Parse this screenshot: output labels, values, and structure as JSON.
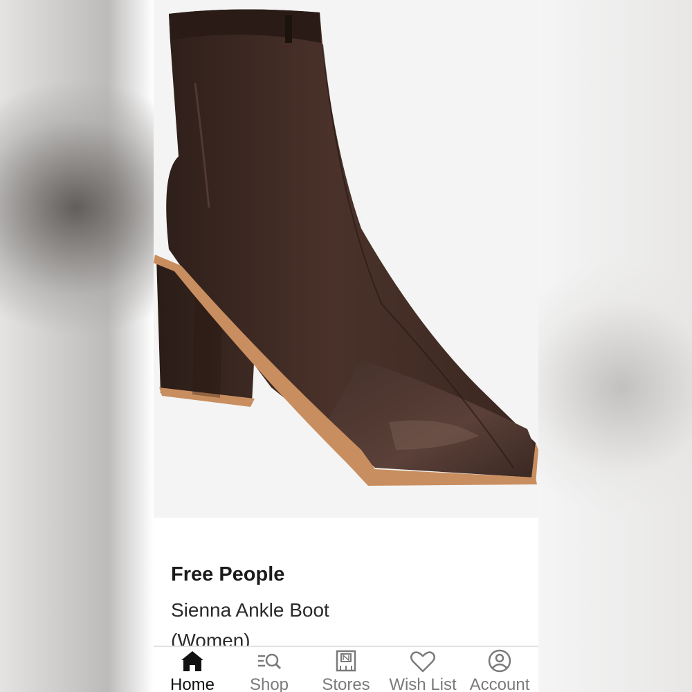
{
  "product": {
    "brand": "Free People",
    "name_line1": "Sienna Ankle Boot",
    "name_line2": "(Women)",
    "image_icon": "brown-leather-ankle-boot-image"
  },
  "tabbar": {
    "active": "home",
    "items": [
      {
        "key": "home",
        "label": "Home",
        "icon": "home-icon"
      },
      {
        "key": "shop",
        "label": "Shop",
        "icon": "shop-search-icon"
      },
      {
        "key": "stores",
        "label": "Stores",
        "icon": "store-icon"
      },
      {
        "key": "wishlist",
        "label": "Wish List",
        "icon": "heart-icon"
      },
      {
        "key": "account",
        "label": "Account",
        "icon": "account-icon"
      }
    ]
  },
  "colors": {
    "boot_leather": "#3f2a24",
    "sole": "#c98e5f",
    "active_tab": "#111111",
    "inactive_tab": "#7a7a7a"
  }
}
